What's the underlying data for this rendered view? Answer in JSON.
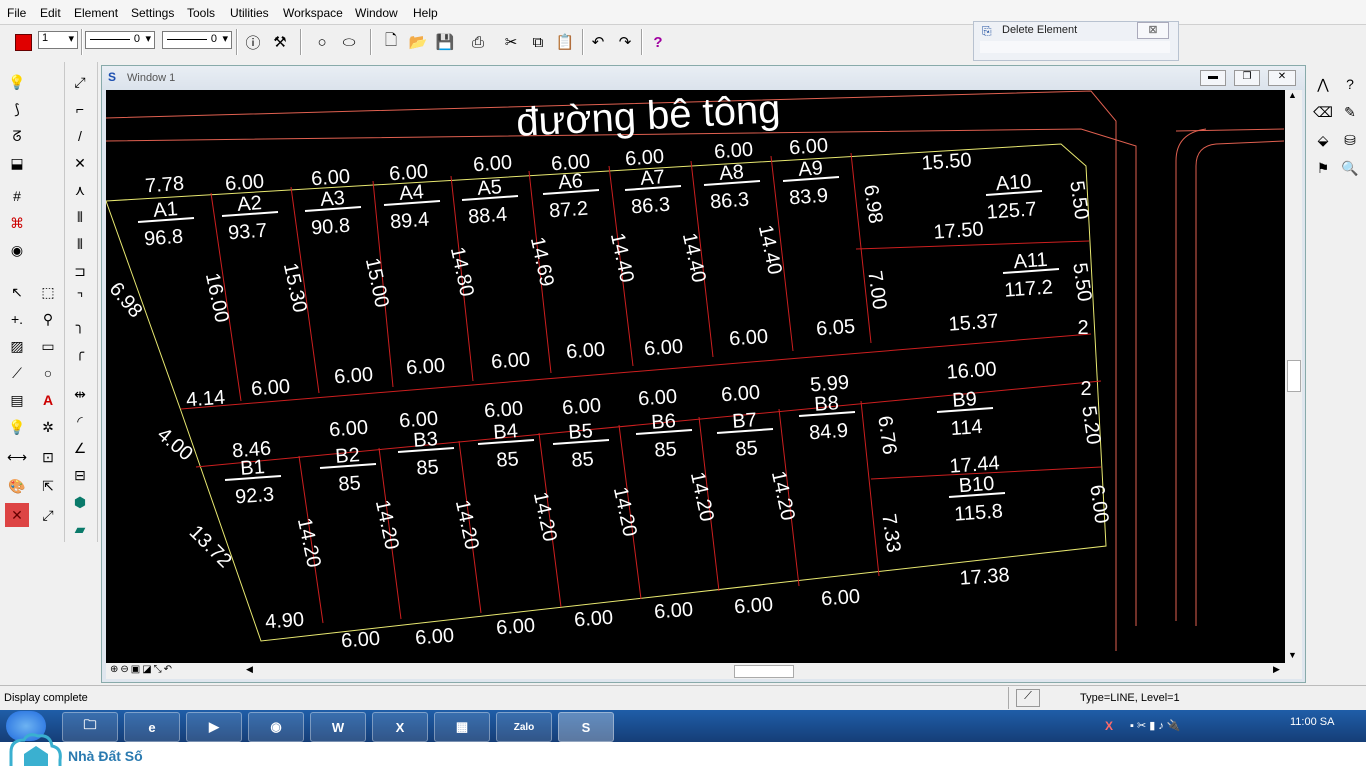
{
  "menu": [
    "File",
    "Edit",
    "Element",
    "Settings",
    "Tools",
    "Utilities",
    "Workspace",
    "Window",
    "Help"
  ],
  "toolbar": {
    "color_swatch": "#e00000",
    "level_value": "1",
    "line_style_value": "0",
    "line_weight_value": "0"
  },
  "delete_panel": {
    "title": "Delete Element",
    "close": "⊠"
  },
  "window": {
    "title": "Window 1"
  },
  "plan": {
    "road_label": "đường bê tông",
    "lots_top": [
      {
        "name": "A1",
        "area": "96.8"
      },
      {
        "name": "A2",
        "area": "93.7"
      },
      {
        "name": "A3",
        "area": "90.8"
      },
      {
        "name": "A4",
        "area": "89.4"
      },
      {
        "name": "A5",
        "area": "88.4"
      },
      {
        "name": "A6",
        "area": "87.2"
      },
      {
        "name": "A7",
        "area": "86.3"
      },
      {
        "name": "A8",
        "area": "86.3"
      },
      {
        "name": "A9",
        "area": "83.9"
      },
      {
        "name": "A10",
        "area": "125.7"
      },
      {
        "name": "A11",
        "area": "117.2"
      }
    ],
    "lots_bottom": [
      {
        "name": "B1",
        "area": "92.3"
      },
      {
        "name": "B2",
        "area": "85"
      },
      {
        "name": "B3",
        "area": "85"
      },
      {
        "name": "B4",
        "area": "85"
      },
      {
        "name": "B5",
        "area": "85"
      },
      {
        "name": "B6",
        "area": "85"
      },
      {
        "name": "B7",
        "area": "85"
      },
      {
        "name": "B8",
        "area": "84.9"
      },
      {
        "name": "B9",
        "area": "114"
      },
      {
        "name": "B10",
        "area": "115.8"
      }
    ],
    "dims_top_front": [
      "7.78",
      "6.00",
      "6.00",
      "6.00",
      "6.00",
      "6.00",
      "6.00",
      "6.00",
      "6.00",
      "15.50"
    ],
    "dims_top_depth": [
      "16.00",
      "15.30",
      "15.00",
      "14.80",
      "14.69",
      "14.40",
      "14.40",
      "14.40"
    ],
    "dims_top_back": [
      "4.14",
      "6.00",
      "6.00",
      "6.00",
      "6.00",
      "6.00",
      "6.00",
      "6.00",
      "6.05",
      "15.37"
    ],
    "dims_mid": [
      "8.46",
      "6.00",
      "6.00",
      "6.00",
      "6.00",
      "6.00",
      "6.00",
      "5.99",
      "16.00"
    ],
    "dims_bottom_depth": [
      "14.20",
      "14.20",
      "14.20",
      "14.20",
      "14.20",
      "14.20",
      "14.20"
    ],
    "dims_bottom_front": [
      "4.90",
      "6.00",
      "6.00",
      "6.00",
      "6.00",
      "6.00",
      "6.00",
      "6.00",
      "17.38"
    ],
    "dims_side": [
      "6.98",
      "17.50",
      "5.50",
      "7.00",
      "5.50",
      "2",
      "2",
      "6.76",
      "5.20",
      "17.44",
      "7.33",
      "6.00"
    ],
    "dims_left": [
      "6.98",
      "4.00",
      "13.72"
    ]
  },
  "status": {
    "message": "Display complete",
    "info": "Type=LINE, Level=1"
  },
  "taskbar": {
    "clock": "11:00 SA",
    "apps": [
      "W",
      "X",
      "Zalo"
    ]
  },
  "brand": {
    "name": "Nhà Đất Số"
  },
  "colors": {
    "canvas": "#000000",
    "text": "#ffffff",
    "lot_line": "#cc1f1f",
    "boundary": "#e8e870",
    "road_line": "#e06050",
    "taskbar": "#1f5ea8"
  }
}
